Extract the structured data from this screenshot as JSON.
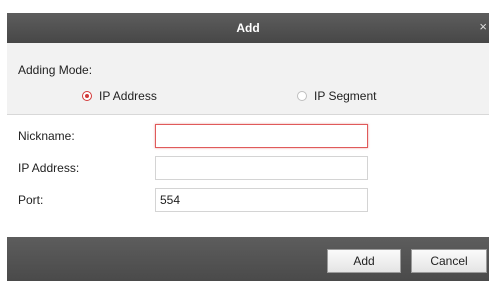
{
  "dialog": {
    "title": "Add",
    "close_glyph": "×"
  },
  "adding_mode": {
    "label": "Adding Mode:",
    "options": [
      {
        "label": "IP Address",
        "selected": true
      },
      {
        "label": "IP Segment",
        "selected": false
      }
    ]
  },
  "form": {
    "nickname_label": "Nickname:",
    "nickname_value": "",
    "ip_address_label": "IP Address:",
    "ip_address_value": "",
    "port_label": "Port:",
    "port_value": "554"
  },
  "buttons": {
    "add_label": "Add",
    "cancel_label": "Cancel"
  },
  "colors": {
    "accent": "#d23a3a",
    "titlebar": "#4f4f4f",
    "section_bg": "#f2f2f2"
  }
}
